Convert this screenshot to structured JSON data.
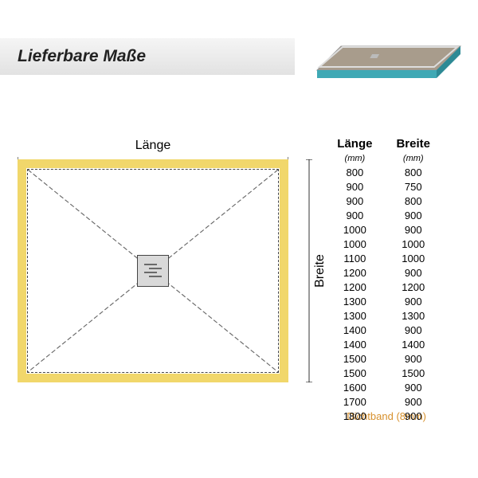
{
  "title": "Lieferbare Maße",
  "diagram": {
    "length_label": "Länge",
    "width_label": "Breite",
    "dichtband_label": "Dichtband (8mm)"
  },
  "table": {
    "col_length": "Länge",
    "col_width": "Breite",
    "unit": "(mm)",
    "rows": [
      {
        "l": "800",
        "b": "800"
      },
      {
        "l": "900",
        "b": "750"
      },
      {
        "l": "900",
        "b": "800"
      },
      {
        "l": "900",
        "b": "900"
      },
      {
        "l": "1000",
        "b": "900"
      },
      {
        "l": "1000",
        "b": "1000"
      },
      {
        "l": "1100",
        "b": "1000"
      },
      {
        "l": "1200",
        "b": "900"
      },
      {
        "l": "1200",
        "b": "1200"
      },
      {
        "l": "1300",
        "b": "900"
      },
      {
        "l": "1300",
        "b": "1300"
      },
      {
        "l": "1400",
        "b": "900"
      },
      {
        "l": "1400",
        "b": "1400"
      },
      {
        "l": "1500",
        "b": "900"
      },
      {
        "l": "1500",
        "b": "1500"
      },
      {
        "l": "1600",
        "b": "900"
      },
      {
        "l": "1700",
        "b": "900"
      },
      {
        "l": "1800",
        "b": "900"
      }
    ]
  }
}
